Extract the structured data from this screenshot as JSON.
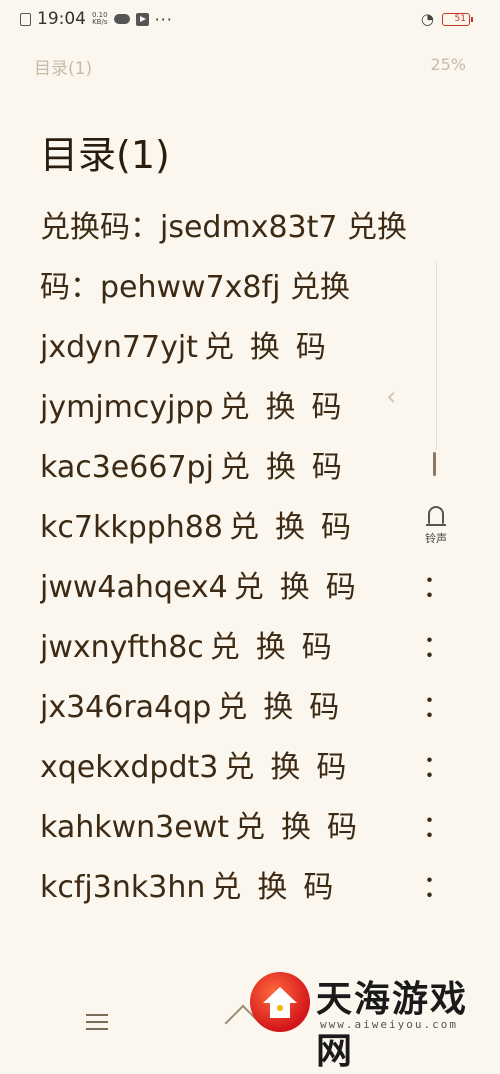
{
  "status_bar": {
    "time": "19:04",
    "speed_value": "0.10",
    "speed_unit": "KB/s",
    "more": "···",
    "battery": "51"
  },
  "reader": {
    "header_title": "目录(1)",
    "progress": "25%",
    "chapter_title": "目录(1)",
    "lines": [
      {
        "code": "兑换码：jsedmx83t7 兑换",
        "cjk": "",
        "colon": ""
      },
      {
        "code": "码：pehww7x8fj 兑换",
        "cjk": "",
        "colon": ""
      },
      {
        "code": "jxdyn77yjt",
        "cjk": "兑换码",
        "colon": ""
      },
      {
        "code": "jymjmcyjpp",
        "cjk": "兑换码",
        "colon": ""
      },
      {
        "code": "kac3e667pj",
        "cjk": "兑换码",
        "colon": ""
      },
      {
        "code": "kc7kkpph88",
        "cjk": "兑换码",
        "colon": ""
      },
      {
        "code": "jww4ahqex4",
        "cjk": "兑换码",
        "colon": "："
      },
      {
        "code": "jwxnyfth8c",
        "cjk": "兑换码",
        "colon": "："
      },
      {
        "code": "jx346ra4qp",
        "cjk": "兑换码",
        "colon": "："
      },
      {
        "code": "xqekxdpdt3",
        "cjk": "兑换码",
        "colon": "："
      },
      {
        "code": "kahkwn3ewt",
        "cjk": "兑换码",
        "colon": "："
      },
      {
        "code": "kcfj3nk3hn",
        "cjk": "兑换码",
        "colon": "："
      }
    ]
  },
  "side_panel": {
    "ringtone_label": "铃声"
  },
  "watermark": {
    "name": "天海游戏网",
    "url": "www.aiweiyou.com"
  }
}
